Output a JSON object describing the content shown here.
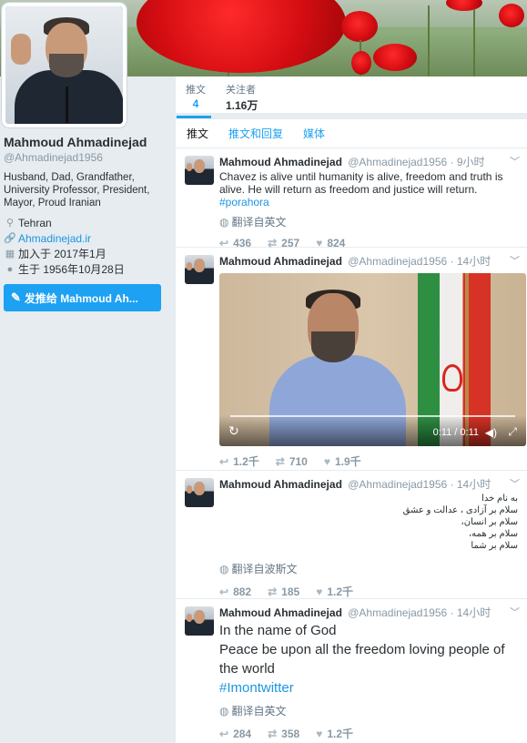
{
  "profile": {
    "name": "Mahmoud Ahmadinejad",
    "handle": "@Ahmadinejad1956",
    "bio": "Husband, Dad, Grandfather, University Professor, President, Mayor, Proud Iranian",
    "location": "Tehran",
    "website": "Ahmadinejad.ir",
    "joined": "加入于 2017年1月",
    "born": "生于 1956年10月28日",
    "tweet_to_label": "发推给 Mahmoud Ah..."
  },
  "stats": {
    "tweets_label": "推文",
    "tweets_value": "4",
    "followers_label": "关注者",
    "followers_value": "1.16万"
  },
  "tabs": [
    "推文",
    "推文和回复",
    "媒体"
  ],
  "tweets": [
    {
      "name": "Mahmoud Ahmadinejad",
      "handle": "@Ahmadinejad1956",
      "time": "· 9小时",
      "text": "Chavez is alive until humanity is alive, freedom and truth is alive. He will return as freedom and justice will return.",
      "hashtag": "#porahora",
      "translate": "翻译自英文",
      "replies": "436",
      "retweets": "257",
      "likes": "824"
    },
    {
      "name": "Mahmoud Ahmadinejad",
      "handle": "@Ahmadinejad1956",
      "time": "· 14小时",
      "video_time": "0:11 / 0:11",
      "replies": "1.2千",
      "retweets": "710",
      "likes": "1.9千"
    },
    {
      "name": "Mahmoud Ahmadinejad",
      "handle": "@Ahmadinejad1956",
      "time": "· 14小时",
      "rtl_lines": [
        "به نام خدا",
        "سلام بر آزادی ، عدالت و عشق",
        "سلام بر انسان،",
        "سلام بر همه،",
        "سلام بر شما"
      ],
      "translate": "翻译自波斯文",
      "replies": "882",
      "retweets": "185",
      "likes": "1.2千"
    },
    {
      "name": "Mahmoud Ahmadinejad",
      "handle": "@Ahmadinejad1956",
      "time": "· 14小时",
      "line1": "In the name of God",
      "line2": "Peace be upon all the freedom loving people of the world",
      "hashtag": "#Imontwitter",
      "translate": "翻译自英文",
      "replies": "284",
      "retweets": "358",
      "likes": "1.2千"
    }
  ],
  "colors": {
    "accent": "#1da1f2",
    "link": "#1b95e0",
    "muted": "#8899a6",
    "bg": "#e6ecf0"
  },
  "icons": {
    "location": "map-pin-icon",
    "link": "link-icon",
    "calendar": "calendar-icon",
    "balloon": "balloon-icon",
    "reply": "reply-icon",
    "retweet": "retweet-icon",
    "like": "heart-icon",
    "globe": "globe-icon",
    "caret": "chevron-down-icon"
  }
}
